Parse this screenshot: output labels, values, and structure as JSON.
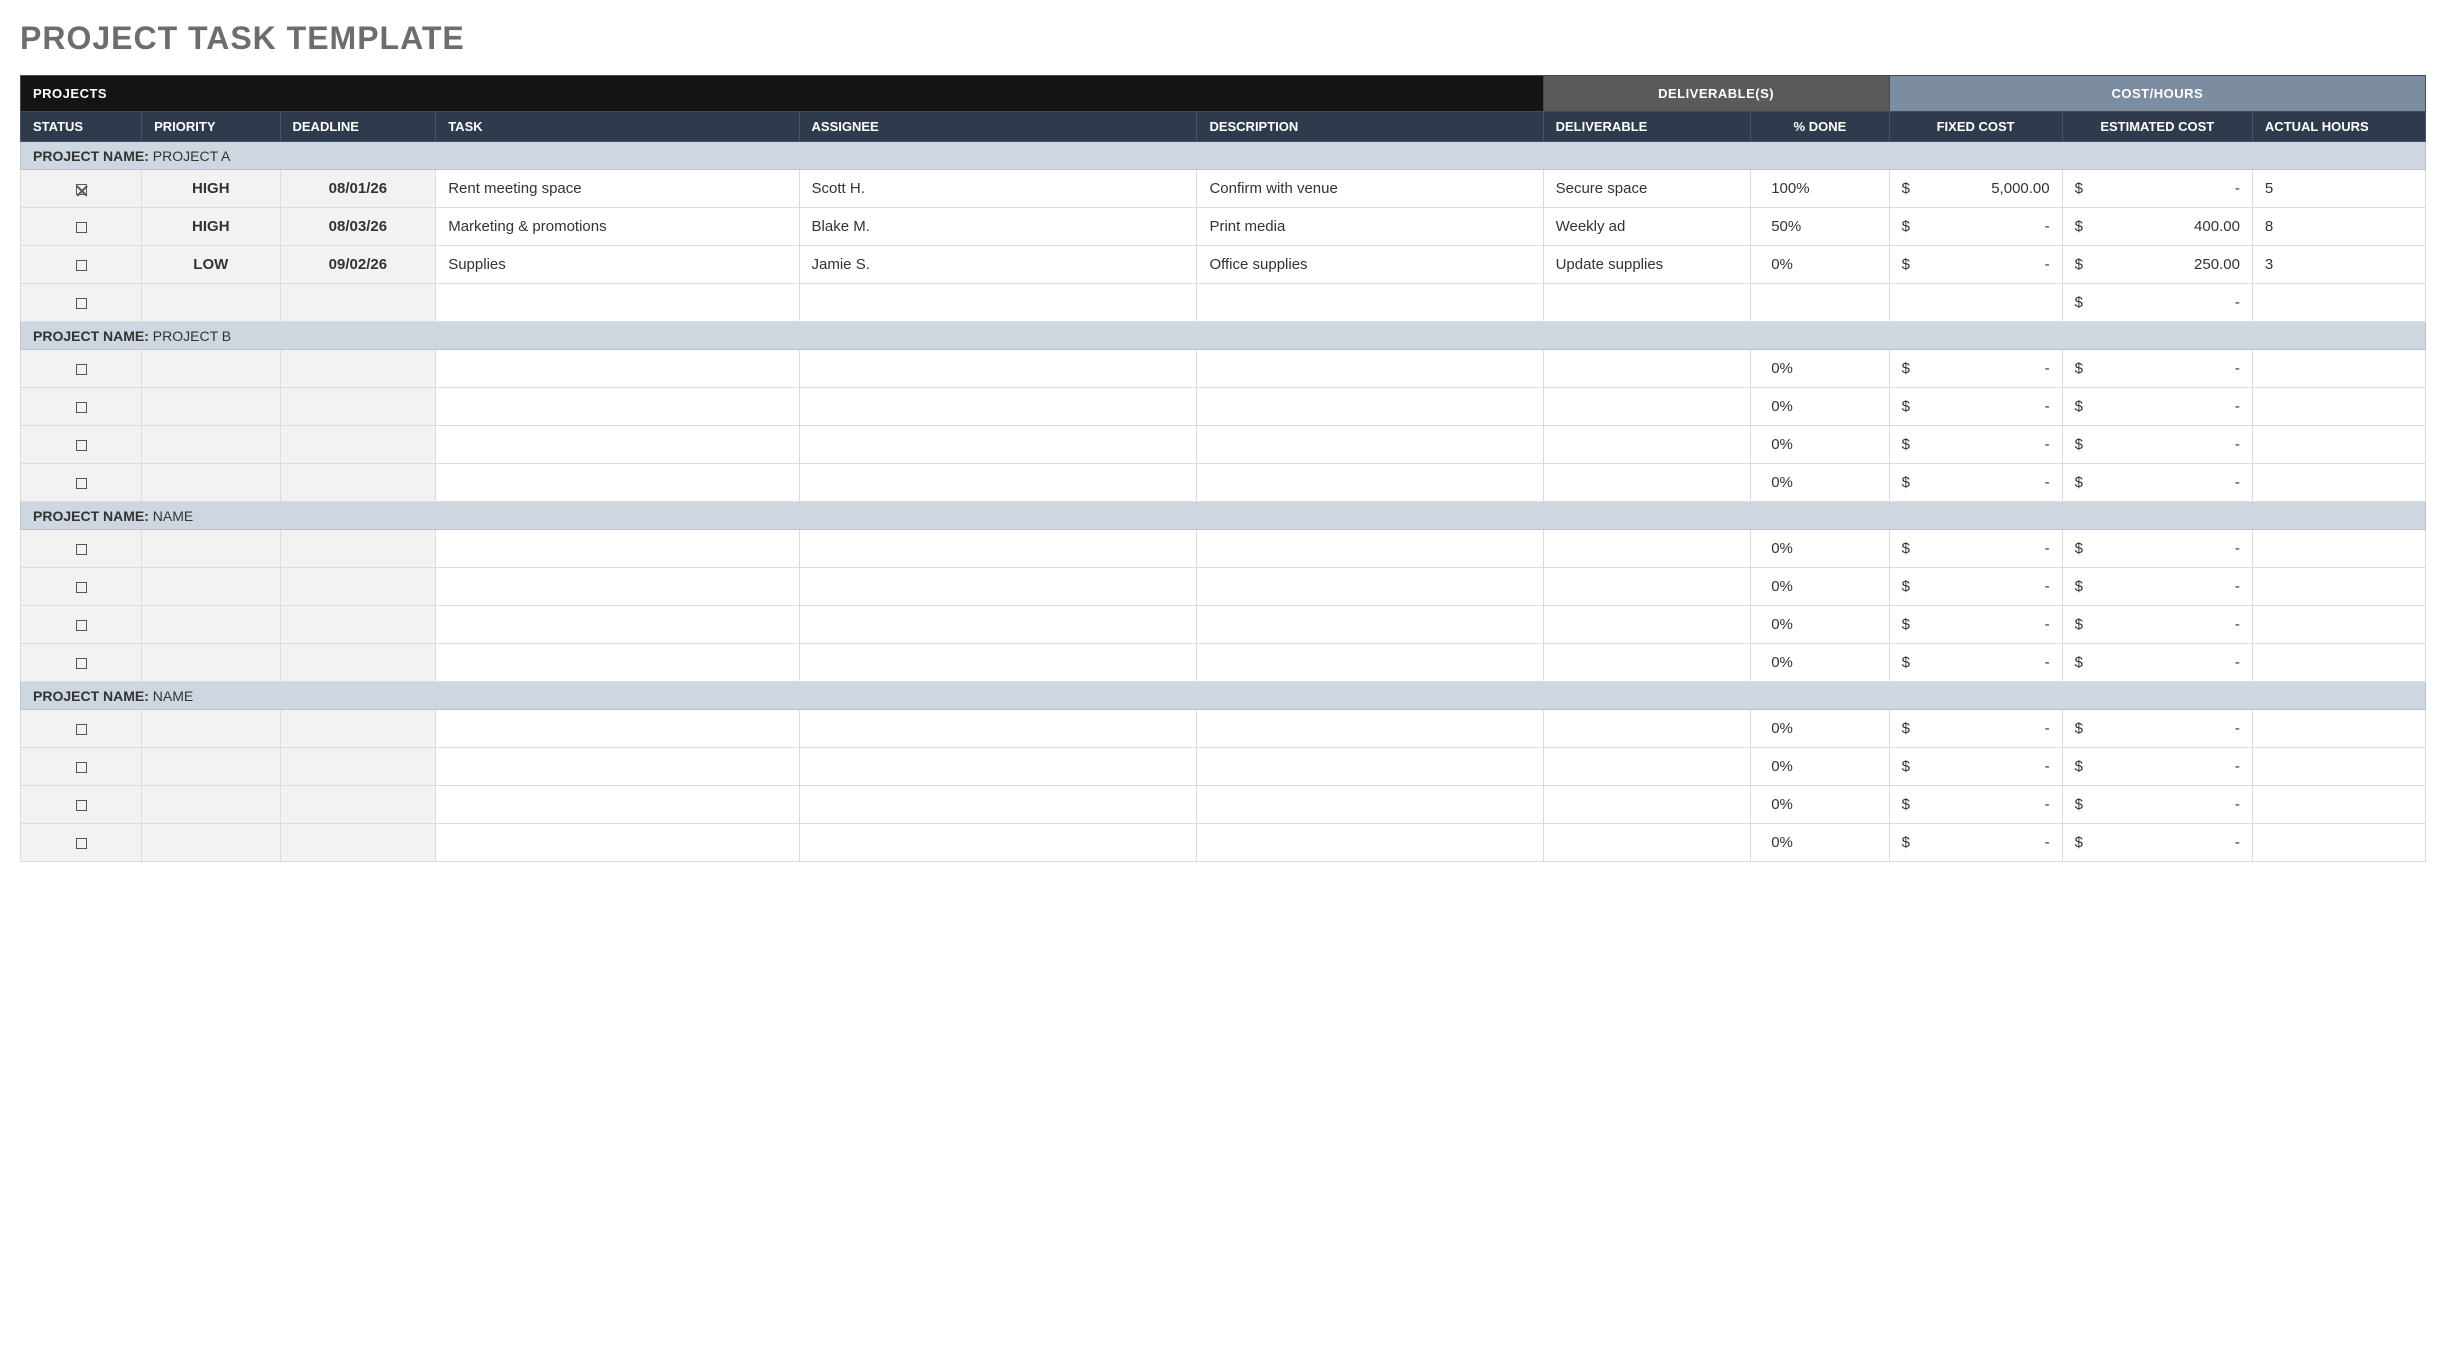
{
  "title": "PROJECT TASK TEMPLATE",
  "superheaders": {
    "projects": "PROJECTS",
    "deliverables": "DELIVERABLE(S)",
    "cost_hours": "COST/HOURS"
  },
  "columns": {
    "status": "STATUS",
    "priority": "PRIORITY",
    "deadline": "DEADLINE",
    "task": "TASK",
    "assignee": "ASSIGNEE",
    "description": "DESCRIPTION",
    "deliverable": "DELIVERABLE",
    "done": "% DONE",
    "fixed_cost": "FIXED COST",
    "estimated_cost": "ESTIMATED COST",
    "actual_hours": "ACTUAL HOURS"
  },
  "section_label": "PROJECT NAME:",
  "currency_symbol": "$",
  "dash": "-",
  "sections": [
    {
      "name": "PROJECT A",
      "rows": [
        {
          "checked": true,
          "priority": "HIGH",
          "deadline": "08/01/26",
          "task": "Rent meeting space",
          "assignee": "Scott H.",
          "description": "Confirm with venue",
          "deliverable": "Secure space",
          "done": "100%",
          "fixed_cost": "5,000.00",
          "estimated_cost": "-",
          "actual_hours": "5"
        },
        {
          "checked": false,
          "priority": "HIGH",
          "deadline": "08/03/26",
          "task": "Marketing & promotions",
          "assignee": "Blake M.",
          "description": "Print media",
          "deliverable": "Weekly ad",
          "done": "50%",
          "fixed_cost": "-",
          "estimated_cost": "400.00",
          "actual_hours": "8"
        },
        {
          "checked": false,
          "priority": "LOW",
          "deadline": "09/02/26",
          "task": "Supplies",
          "assignee": "Jamie S.",
          "description": "Office supplies",
          "deliverable": "Update supplies",
          "done": "0%",
          "fixed_cost": "-",
          "estimated_cost": "250.00",
          "actual_hours": "3"
        },
        {
          "checked": false,
          "priority": "",
          "deadline": "",
          "task": "",
          "assignee": "",
          "description": "",
          "deliverable": "",
          "done": "",
          "fixed_cost": "",
          "estimated_cost": "-",
          "actual_hours": ""
        }
      ]
    },
    {
      "name": "PROJECT B",
      "rows": [
        {
          "checked": false,
          "priority": "",
          "deadline": "",
          "task": "",
          "assignee": "",
          "description": "",
          "deliverable": "",
          "done": "0%",
          "fixed_cost": "-",
          "estimated_cost": "-",
          "actual_hours": ""
        },
        {
          "checked": false,
          "priority": "",
          "deadline": "",
          "task": "",
          "assignee": "",
          "description": "",
          "deliverable": "",
          "done": "0%",
          "fixed_cost": "-",
          "estimated_cost": "-",
          "actual_hours": ""
        },
        {
          "checked": false,
          "priority": "",
          "deadline": "",
          "task": "",
          "assignee": "",
          "description": "",
          "deliverable": "",
          "done": "0%",
          "fixed_cost": "-",
          "estimated_cost": "-",
          "actual_hours": ""
        },
        {
          "checked": false,
          "priority": "",
          "deadline": "",
          "task": "",
          "assignee": "",
          "description": "",
          "deliverable": "",
          "done": "0%",
          "fixed_cost": "-",
          "estimated_cost": "-",
          "actual_hours": ""
        }
      ]
    },
    {
      "name": "NAME",
      "rows": [
        {
          "checked": false,
          "priority": "",
          "deadline": "",
          "task": "",
          "assignee": "",
          "description": "",
          "deliverable": "",
          "done": "0%",
          "fixed_cost": "-",
          "estimated_cost": "-",
          "actual_hours": ""
        },
        {
          "checked": false,
          "priority": "",
          "deadline": "",
          "task": "",
          "assignee": "",
          "description": "",
          "deliverable": "",
          "done": "0%",
          "fixed_cost": "-",
          "estimated_cost": "-",
          "actual_hours": ""
        },
        {
          "checked": false,
          "priority": "",
          "deadline": "",
          "task": "",
          "assignee": "",
          "description": "",
          "deliverable": "",
          "done": "0%",
          "fixed_cost": "-",
          "estimated_cost": "-",
          "actual_hours": ""
        },
        {
          "checked": false,
          "priority": "",
          "deadline": "",
          "task": "",
          "assignee": "",
          "description": "",
          "deliverable": "",
          "done": "0%",
          "fixed_cost": "-",
          "estimated_cost": "-",
          "actual_hours": ""
        }
      ]
    },
    {
      "name": "NAME",
      "rows": [
        {
          "checked": false,
          "priority": "",
          "deadline": "",
          "task": "",
          "assignee": "",
          "description": "",
          "deliverable": "",
          "done": "0%",
          "fixed_cost": "-",
          "estimated_cost": "-",
          "actual_hours": ""
        },
        {
          "checked": false,
          "priority": "",
          "deadline": "",
          "task": "",
          "assignee": "",
          "description": "",
          "deliverable": "",
          "done": "0%",
          "fixed_cost": "-",
          "estimated_cost": "-",
          "actual_hours": ""
        },
        {
          "checked": false,
          "priority": "",
          "deadline": "",
          "task": "",
          "assignee": "",
          "description": "",
          "deliverable": "",
          "done": "0%",
          "fixed_cost": "-",
          "estimated_cost": "-",
          "actual_hours": ""
        },
        {
          "checked": false,
          "priority": "",
          "deadline": "",
          "task": "",
          "assignee": "",
          "description": "",
          "deliverable": "",
          "done": "0%",
          "fixed_cost": "-",
          "estimated_cost": "-",
          "actual_hours": ""
        }
      ]
    }
  ]
}
